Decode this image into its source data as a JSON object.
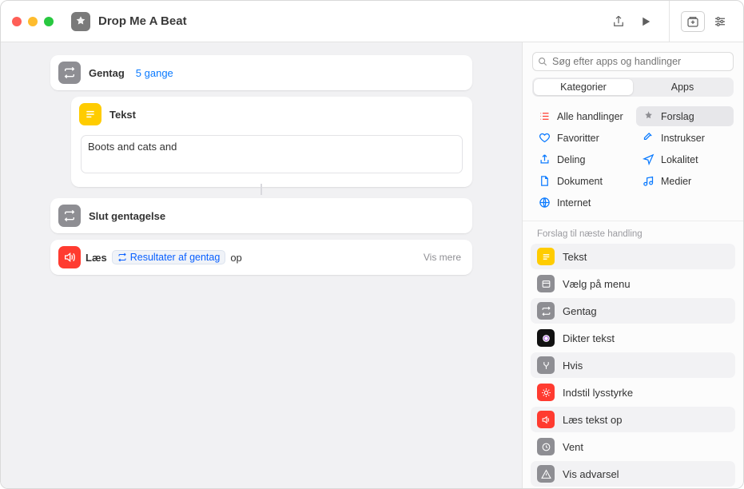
{
  "window": {
    "title": "Drop Me A Beat"
  },
  "toolbar": {
    "share": "Share",
    "run": "Run",
    "library": "Library",
    "settings": "Settings"
  },
  "editor": {
    "repeat": {
      "label": "Gentag",
      "count_token": "5 gange"
    },
    "text": {
      "label": "Tekst",
      "value": "Boots and cats and "
    },
    "endrepeat": {
      "label": "Slut gentagelse"
    },
    "speak": {
      "label": "Læs",
      "var": "Resultater af gentag",
      "suffix": "op",
      "more": "Vis mere"
    }
  },
  "sidebar": {
    "search_placeholder": "Søg efter apps og handlinger",
    "tabs": {
      "categories": "Kategorier",
      "apps": "Apps"
    },
    "cats": {
      "all": "Alle handlinger",
      "suggestions": "Forslag",
      "favorites": "Favoritter",
      "scripting": "Instrukser",
      "sharing": "Deling",
      "location": "Lokalitet",
      "document": "Dokument",
      "media": "Medier",
      "internet": "Internet"
    },
    "sug_header": "Forslag til næste handling",
    "suggestions": [
      {
        "label": "Tekst",
        "color": "#ffcc00",
        "icon": "lines"
      },
      {
        "label": "Vælg på menu",
        "color": "#8e8e93",
        "icon": "menu"
      },
      {
        "label": "Gentag",
        "color": "#8e8e93",
        "icon": "repeat"
      },
      {
        "label": "Dikter tekst",
        "color": "#111111",
        "icon": "siri"
      },
      {
        "label": "Hvis",
        "color": "#8e8e93",
        "icon": "branch"
      },
      {
        "label": "Indstil lysstyrke",
        "color": "#ff3b30",
        "icon": "sun"
      },
      {
        "label": "Læs tekst op",
        "color": "#ff3b30",
        "icon": "speak"
      },
      {
        "label": "Vent",
        "color": "#8e8e93",
        "icon": "clock"
      },
      {
        "label": "Vis advarsel",
        "color": "#8e8e93",
        "icon": "alert"
      }
    ]
  }
}
